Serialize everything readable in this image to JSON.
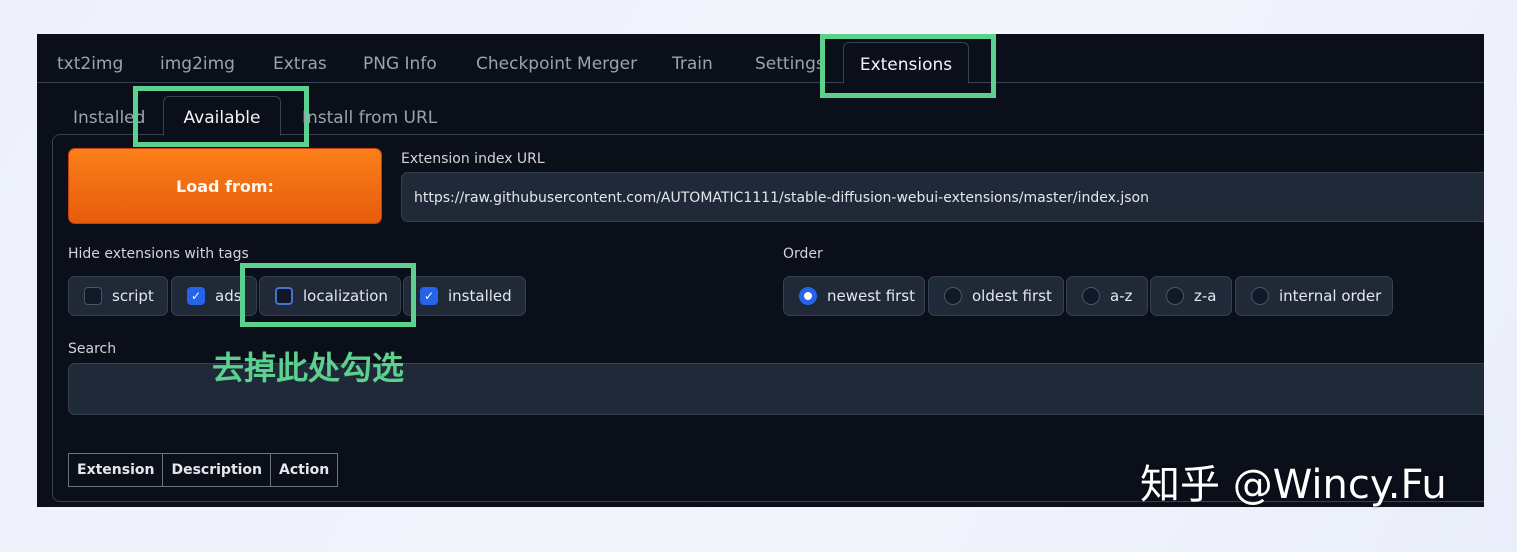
{
  "top_tabs": [
    "txt2img",
    "img2img",
    "Extras",
    "PNG Info",
    "Checkpoint Merger",
    "Train",
    "Settings",
    "Extensions"
  ],
  "active_top_tab": "Extensions",
  "sub_tabs": [
    "Installed",
    "Available",
    "Install from URL"
  ],
  "active_sub_tab": "Available",
  "load_button": "Load from:",
  "index_url": {
    "label": "Extension index URL",
    "value": "https://raw.githubusercontent.com/AUTOMATIC1111/stable-diffusion-webui-extensions/master/index.json"
  },
  "hide_tags": {
    "label": "Hide extensions with tags",
    "options": [
      {
        "label": "script",
        "checked": false
      },
      {
        "label": "ads",
        "checked": true
      },
      {
        "label": "localization",
        "checked": false
      },
      {
        "label": "installed",
        "checked": true
      }
    ]
  },
  "order": {
    "label": "Order",
    "options": [
      "newest first",
      "oldest first",
      "a-z",
      "z-a",
      "internal order"
    ],
    "selected": "newest first"
  },
  "search": {
    "label": "Search",
    "value": ""
  },
  "table_headers": [
    "Extension",
    "Description",
    "Action"
  ],
  "annotation": {
    "text": "去掉此处勾选",
    "color": "#5cd08e"
  },
  "watermark": "知乎 @Wincy.Fu",
  "colors": {
    "accent_green": "#5cd08e",
    "button_orange": "#f97316",
    "check_blue": "#2563eb",
    "background": "#0b0f19"
  }
}
